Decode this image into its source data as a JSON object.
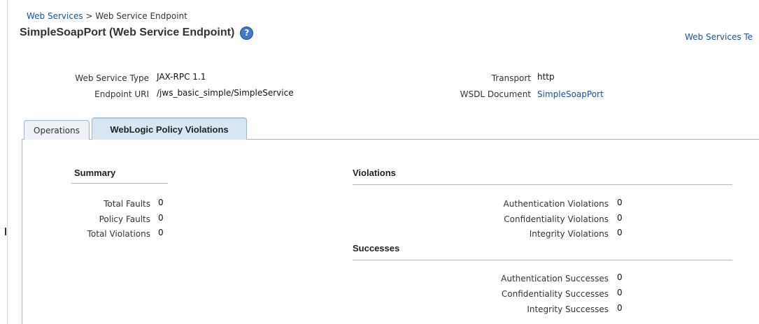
{
  "breadcrumb": {
    "parent": "Web Services",
    "separator": ">",
    "current": "Web Service Endpoint"
  },
  "page": {
    "title": "SimpleSoapPort (Web Service Endpoint)",
    "help_icon_glyph": "?",
    "top_right_link": "Web Services Te"
  },
  "info": {
    "web_service_type_label": "Web Service Type",
    "web_service_type_value": "JAX-RPC 1.1",
    "endpoint_uri_label": "Endpoint URI",
    "endpoint_uri_value": "/jws_basic_simple/SimpleService",
    "transport_label": "Transport",
    "transport_value": "http",
    "wsdl_label": "WSDL Document",
    "wsdl_value": "SimpleSoapPort"
  },
  "tabs": [
    {
      "label": "Operations",
      "active": false
    },
    {
      "label": "WebLogic Policy Violations",
      "active": true
    }
  ],
  "summary": {
    "heading": "Summary",
    "rows": [
      {
        "label": "Total Faults",
        "value": "0"
      },
      {
        "label": "Policy Faults",
        "value": "0"
      },
      {
        "label": "Total Violations",
        "value": "0"
      }
    ]
  },
  "violations": {
    "heading": "Violations",
    "rows": [
      {
        "label": "Authentication Violations",
        "value": "0"
      },
      {
        "label": "Confidentiality Violations",
        "value": "0"
      },
      {
        "label": "Integrity Violations",
        "value": "0"
      }
    ]
  },
  "successes": {
    "heading": "Successes",
    "rows": [
      {
        "label": "Authentication Successes",
        "value": "0"
      },
      {
        "label": "Confidentiality Successes",
        "value": "0"
      },
      {
        "label": "Integrity Successes",
        "value": "0"
      }
    ]
  },
  "colors": {
    "link": "#1e4fa0",
    "active_tab": "#d8e6f4",
    "tab_border": "#9eb6d0",
    "help_icon": "#3f78c8"
  }
}
